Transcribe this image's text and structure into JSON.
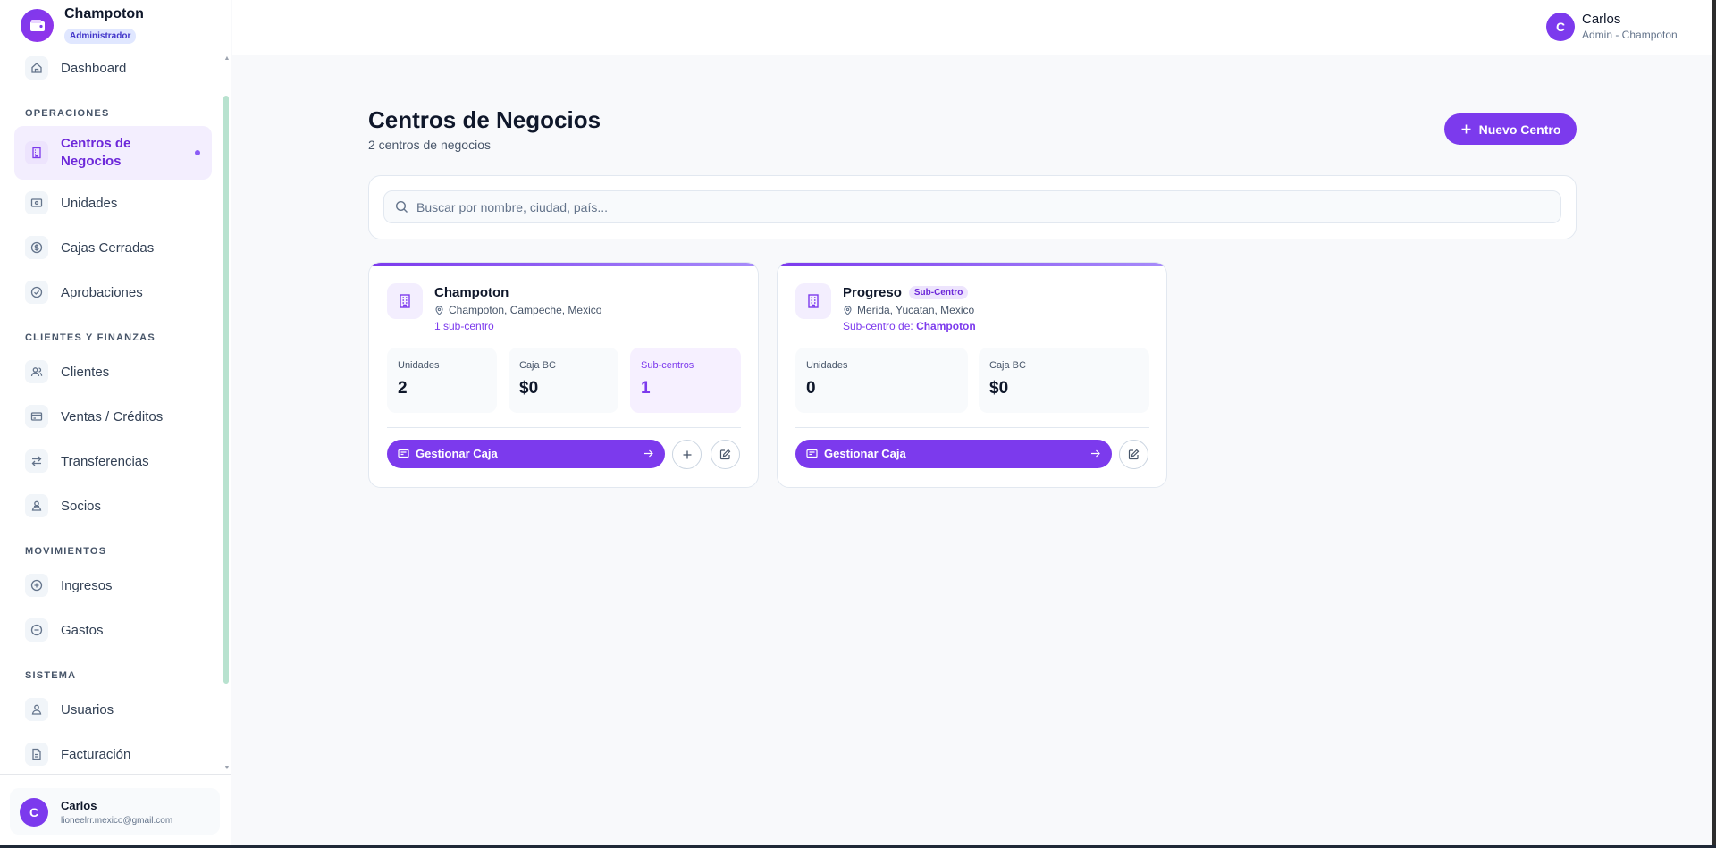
{
  "brand": {
    "name": "Champoton",
    "role": "Administrador"
  },
  "nav": {
    "dashboard": "Dashboard",
    "sections": {
      "operaciones": "OPERACIONES",
      "clientes_finanzas": "CLIENTES Y FINANZAS",
      "movimientos": "MOVIMIENTOS",
      "sistema": "SISTEMA"
    },
    "items": {
      "centros": "Centros de Negocios",
      "unidades": "Unidades",
      "cajas": "Cajas Cerradas",
      "aprobaciones": "Aprobaciones",
      "clientes": "Clientes",
      "ventas": "Ventas / Créditos",
      "transferencias": "Transferencias",
      "socios": "Socios",
      "ingresos": "Ingresos",
      "gastos": "Gastos",
      "usuarios": "Usuarios",
      "facturacion": "Facturación"
    }
  },
  "sidebar_user": {
    "initial": "C",
    "name": "Carlos",
    "email": "lioneelrr.mexico@gmail.com"
  },
  "topbar_user": {
    "initial": "C",
    "name": "Carlos",
    "subtitle": "Admin - Champoton"
  },
  "page": {
    "title": "Centros de Negocios",
    "subtitle": "2 centros de negocios",
    "new_button": "Nuevo Centro",
    "search_placeholder": "Buscar por nombre, ciudad, país..."
  },
  "cards": [
    {
      "name": "Champoton",
      "location": "Champoton, Campeche, Mexico",
      "link": "1 sub-centro",
      "stats": [
        {
          "label": "Unidades",
          "value": "2"
        },
        {
          "label": "Caja BC",
          "value": "$0"
        },
        {
          "label": "Sub-centros",
          "value": "1"
        }
      ],
      "action": "Gestionar Caja"
    },
    {
      "name": "Progreso",
      "tag": "Sub-Centro",
      "location": "Merida, Yucatan, Mexico",
      "link_prefix": "Sub-centro de:",
      "link_parent": "Champoton",
      "stats": [
        {
          "label": "Unidades",
          "value": "0"
        },
        {
          "label": "Caja BC",
          "value": "$0"
        }
      ],
      "action": "Gestionar Caja"
    }
  ],
  "colors": {
    "accent": "#7c3aed",
    "accent_light": "#f3eefe",
    "background": "#f8f9fb"
  }
}
